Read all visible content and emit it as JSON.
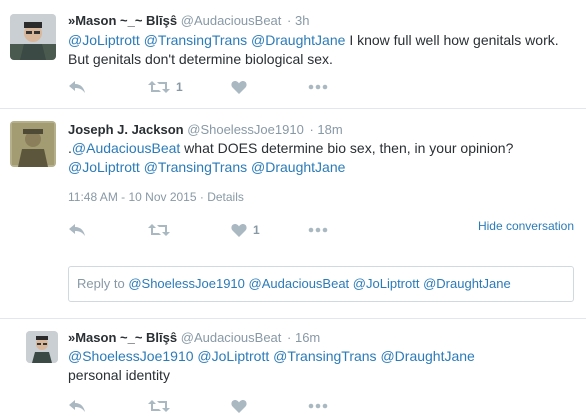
{
  "tweets": [
    {
      "name": "»Mason ~_~ Blīşŝ",
      "handle": "@AudaciousBeat",
      "time": "· 3h",
      "text_mentions": [
        "@JoLiptrott",
        "@TransingTrans",
        "@DraughtJane"
      ],
      "text_body": "I know full well how genitals work. But genitals don't determine biological sex.",
      "retweets": "1",
      "likes": ""
    },
    {
      "name": "Joseph J. Jackson",
      "handle": "@ShoelessJoe1910",
      "time": "· 18m",
      "text_prefix": ".",
      "text_mention_first": "@AudaciousBeat",
      "text_body": " what DOES determine bio sex, then, in your opinion?",
      "text_mentions": [
        "@JoLiptrott",
        "@TransingTrans",
        "@DraughtJane"
      ],
      "timestamp": "11:48 AM - 10 Nov 2015",
      "details": "· Details",
      "retweets": "",
      "likes": "1",
      "hide_conversation": "Hide conversation"
    },
    {
      "name": "»Mason ~_~ Blīşŝ",
      "handle": "@AudaciousBeat",
      "time": "· 16m",
      "text_mentions": [
        "@ShoelessJoe1910",
        "@JoLiptrott",
        "@TransingTrans",
        "@DraughtJane"
      ],
      "text_body": "personal identity",
      "retweets": "",
      "likes": ""
    }
  ],
  "reply_box": {
    "prefix": "Reply to",
    "mentions": [
      "@ShoelessJoe1910",
      "@AudaciousBeat",
      "@JoLiptrott",
      "@DraughtJane"
    ]
  },
  "icons": [
    "reply-icon",
    "retweet-icon",
    "like-icon",
    "more-icon"
  ],
  "colors": {
    "link": "#2b7bb9",
    "muted": "#8899a6",
    "icon": "#aab8c2",
    "border": "#e1e8ed"
  }
}
